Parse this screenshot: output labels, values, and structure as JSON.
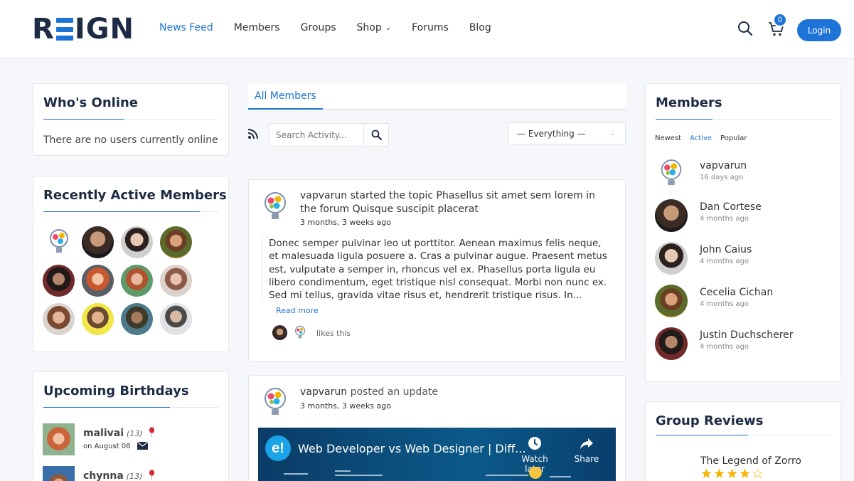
{
  "header": {
    "logo": "REIGN",
    "nav": [
      {
        "label": "News Feed",
        "active": true
      },
      {
        "label": "Members"
      },
      {
        "label": "Groups"
      },
      {
        "label": "Shop",
        "has_dropdown": true
      },
      {
        "label": "Forums"
      },
      {
        "label": "Blog"
      }
    ],
    "cart_count": "0",
    "login_label": "Login",
    "accent_color": "#1e73d8"
  },
  "whos_online": {
    "title": "Who's Online",
    "empty_text": "There are no users currently online"
  },
  "recently_active": {
    "title": "Recently Active Members"
  },
  "birthdays": {
    "title": "Upcoming Birthdays",
    "items": [
      {
        "name": "malivai",
        "age": "(13)",
        "date": "on August 08"
      },
      {
        "name": "chynna",
        "age": "(13)"
      }
    ]
  },
  "activity": {
    "tab_label": "All Members",
    "search_placeholder": "Search Activity...",
    "filter_label": "— Everything —",
    "posts": [
      {
        "author": "vapvarun",
        "action": "started the topic",
        "topic": "Phasellus sit amet sem lorem in the",
        "action2": "forum",
        "forum": "Quisque suscipit placerat",
        "time": "3 months, 3 weeks ago",
        "body": "Donec semper pulvinar leo ut porttitor. Aenean maximus felis neque, et malesuada ligula posuere a. Cras a pulvinar augue. Praesent metus est, vulputate a semper in, rhoncus vel ex. Phasellus porta ligula eu libero condimentum, eget tristique nisl consequat. Morbi non nunc ex. Sed mi tellus, gravida vitae risus et, hendrerit tristique risus. In...",
        "read_more": "Read more",
        "likes_text": "likes this"
      },
      {
        "author": "vapvarun",
        "action": "posted an update",
        "time": "3 months, 3 weeks ago",
        "video_title": "Web Developer vs Web Designer | Diff...",
        "video_watch_later": "Watch later",
        "video_share": "Share"
      }
    ]
  },
  "members": {
    "title": "Members",
    "tabs": [
      {
        "label": "Newest"
      },
      {
        "label": "Active",
        "active": true
      },
      {
        "label": "Popular"
      }
    ],
    "list": [
      {
        "name": "vapvarun",
        "time": "16 days ago"
      },
      {
        "name": "Dan Cortese",
        "time": "4 months ago"
      },
      {
        "name": "John Caius",
        "time": "4 months ago"
      },
      {
        "name": "Cecelia Cichan",
        "time": "4 months ago"
      },
      {
        "name": "Justin Duchscherer",
        "time": "4 months ago"
      }
    ]
  },
  "group_reviews": {
    "title": "Group Reviews",
    "items": [
      {
        "name": "The Legend of Zorro",
        "rating": 4,
        "max": 5
      }
    ]
  }
}
